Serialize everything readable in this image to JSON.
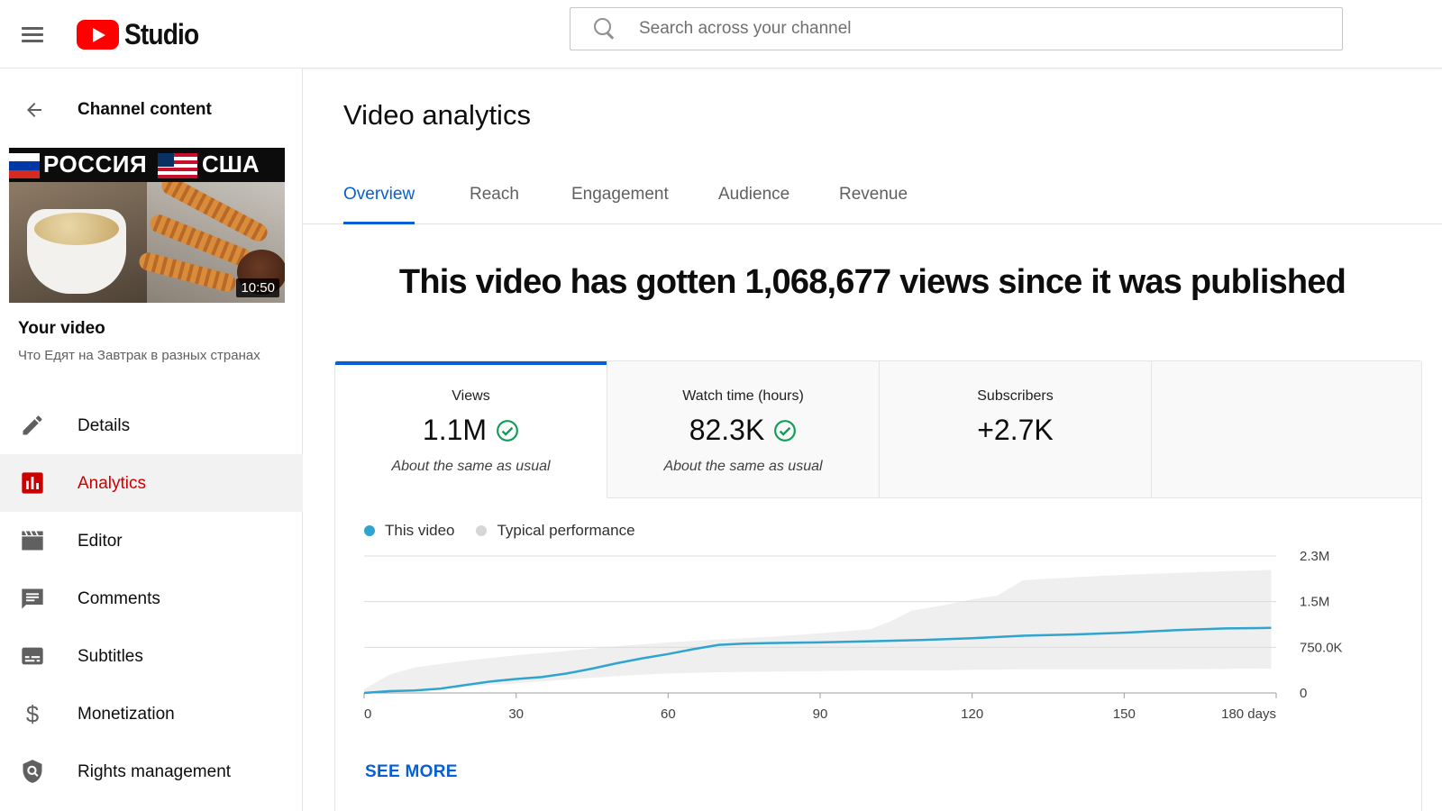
{
  "app": {
    "brand": "Studio",
    "search": {
      "placeholder": "Search across your channel",
      "value": ""
    }
  },
  "sidebar": {
    "back_label": "Channel content",
    "thumbnail": {
      "left_caption": "РОССИЯ",
      "right_caption": "США",
      "duration": "10:50"
    },
    "your_video_label": "Your video",
    "video_title": "Что Едят на Завтрак в разных странах",
    "items": [
      {
        "label": "Details",
        "icon": "pencil-icon",
        "active": false
      },
      {
        "label": "Analytics",
        "icon": "analytics-icon",
        "active": true
      },
      {
        "label": "Editor",
        "icon": "clapperboard-icon",
        "active": false
      },
      {
        "label": "Comments",
        "icon": "comment-icon",
        "active": false
      },
      {
        "label": "Subtitles",
        "icon": "subtitles-icon",
        "active": false
      },
      {
        "label": "Monetization",
        "icon": "dollar-icon",
        "active": false
      },
      {
        "label": "Rights management",
        "icon": "shield-icon",
        "active": false
      }
    ]
  },
  "main": {
    "title": "Video analytics",
    "tabs": [
      {
        "label": "Overview",
        "active": true
      },
      {
        "label": "Reach",
        "active": false
      },
      {
        "label": "Engagement",
        "active": false
      },
      {
        "label": "Audience",
        "active": false
      },
      {
        "label": "Revenue",
        "active": false
      }
    ],
    "headline": "This video has gotten 1,068,677 views since it was published",
    "metrics": [
      {
        "label": "Views",
        "value": "1.1M",
        "note": "About the same as usual",
        "check": true
      },
      {
        "label": "Watch time (hours)",
        "value": "82.3K",
        "note": "About the same as usual",
        "check": true
      },
      {
        "label": "Subscribers",
        "value": "+2.7K",
        "note": "",
        "check": false
      }
    ],
    "see_more": "SEE MORE"
  },
  "colors": {
    "accent": "#065fd4",
    "brand_red": "#ff0000",
    "active_nav": "#cc0000",
    "this_video": "#2fa4cf",
    "typical": "#d6d6d6",
    "check": "#0f9d58"
  },
  "chart_data": {
    "type": "line",
    "legend": [
      "This video",
      "Typical performance"
    ],
    "x_ticks": [
      "0",
      "30",
      "60",
      "90",
      "120",
      "150",
      "180 days"
    ],
    "x_tick_values": [
      0,
      30,
      60,
      90,
      120,
      150,
      180
    ],
    "y_ticks": [
      "0",
      "750.0K",
      "1.5M",
      "2.3M"
    ],
    "y_tick_values": [
      0,
      750000,
      1500000,
      2250000
    ],
    "xlim": [
      0,
      180
    ],
    "ylim": [
      0,
      2250000
    ],
    "grid": true,
    "series": [
      {
        "name": "This video",
        "x": [
          0,
          5,
          10,
          15,
          20,
          25,
          30,
          35,
          40,
          45,
          50,
          55,
          60,
          65,
          70,
          75,
          80,
          90,
          100,
          110,
          120,
          130,
          140,
          150,
          160,
          170,
          179
        ],
        "values": [
          0,
          30000,
          40000,
          70000,
          130000,
          190000,
          230000,
          260000,
          320000,
          400000,
          490000,
          570000,
          640000,
          720000,
          790000,
          810000,
          820000,
          830000,
          850000,
          870000,
          900000,
          940000,
          960000,
          990000,
          1030000,
          1060000,
          1068677
        ]
      }
    ],
    "band": {
      "name": "Typical performance",
      "x": [
        0,
        5,
        10,
        20,
        30,
        40,
        50,
        60,
        70,
        80,
        90,
        100,
        104,
        108,
        115,
        120,
        125,
        130,
        140,
        150,
        160,
        170,
        179
      ],
      "upper": [
        60000,
        300000,
        420000,
        530000,
        620000,
        690000,
        770000,
        830000,
        880000,
        920000,
        980000,
        1050000,
        1180000,
        1350000,
        1450000,
        1540000,
        1600000,
        1850000,
        1900000,
        1940000,
        1970000,
        2000000,
        2020000
      ],
      "lower": [
        0,
        20000,
        50000,
        100000,
        160000,
        220000,
        280000,
        320000,
        340000,
        350000,
        360000,
        370000,
        370000,
        370000,
        370000,
        380000,
        380000,
        390000,
        390000,
        390000,
        390000,
        395000,
        400000
      ]
    }
  }
}
